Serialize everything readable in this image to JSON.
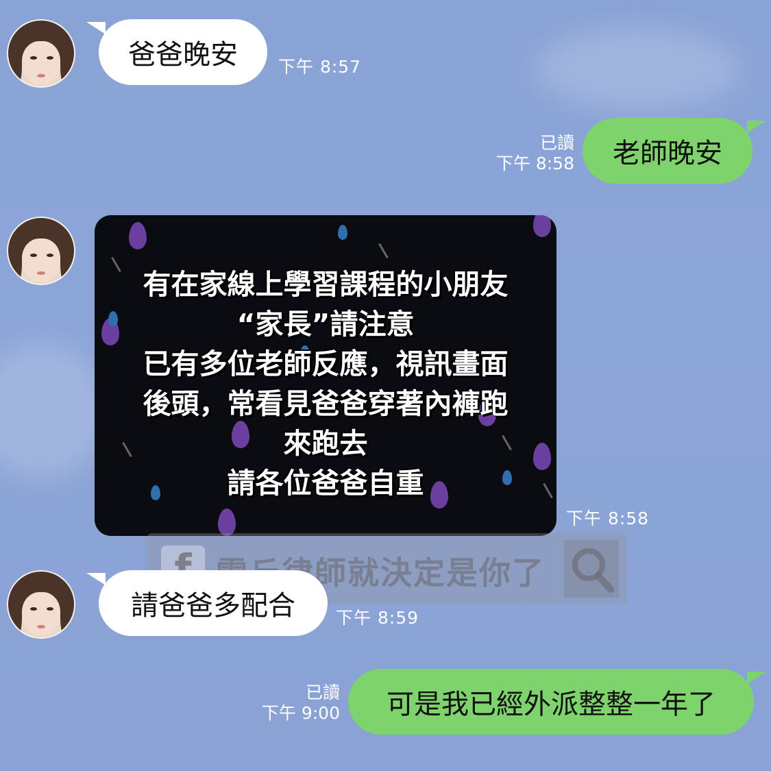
{
  "messages": [
    {
      "side": "in",
      "text": "爸爸晚安",
      "time": "下午 8:57"
    },
    {
      "side": "out",
      "text": "老師晚安",
      "read": "已讀",
      "time": "下午 8:58"
    },
    {
      "side": "in",
      "type": "image",
      "time": "下午 8:58",
      "image_lines": [
        "有在家線上學習課程的小朋友",
        "“家長”請注意",
        "已有多位老師反應，視訊畫面",
        "後頭，常看見爸爸穿著內褲跑",
        "來跑去",
        "請各位爸爸自重"
      ]
    },
    {
      "side": "in",
      "text": "請爸爸多配合",
      "time": "下午 8:59"
    },
    {
      "side": "out",
      "text": "可是我已經外派整整一年了",
      "read": "已讀",
      "time": "下午 9:00"
    }
  ],
  "watermark": {
    "icon": "facebook-icon",
    "text": "雷丘律師就決定是你了",
    "search_icon": "search-icon"
  },
  "colors": {
    "background": "#8aa3d6",
    "incoming": "#ffffff",
    "outgoing": "#7ed36c"
  }
}
